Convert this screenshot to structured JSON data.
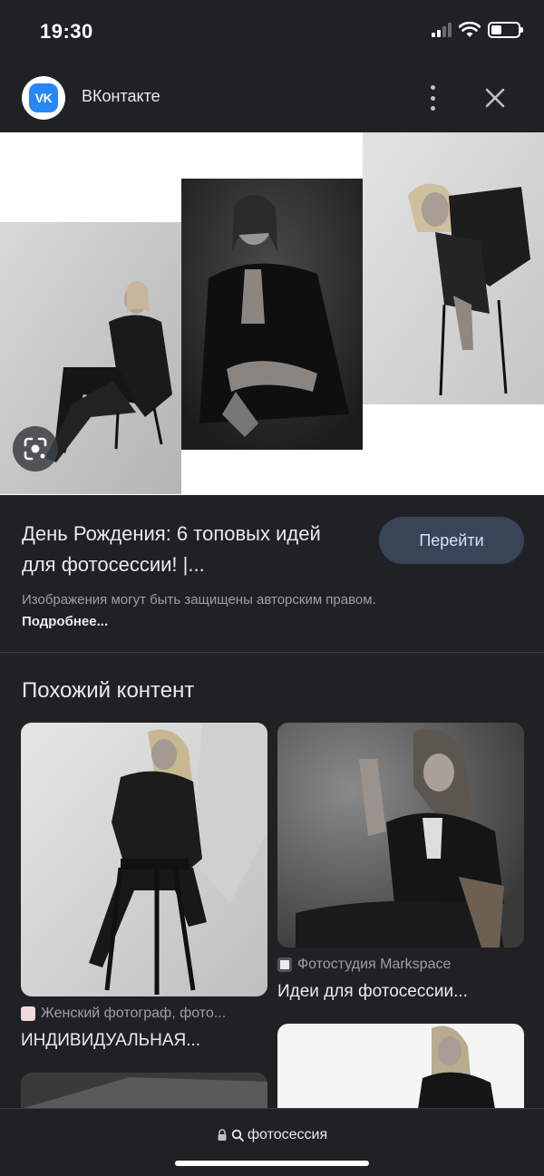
{
  "status_bar": {
    "time": "19:30"
  },
  "header": {
    "site_name": "ВКонтакте",
    "logo_text": "VK"
  },
  "result": {
    "title": "День Рождения: 6 топовых идей для фотосессии! |...",
    "visit_label": "Перейти",
    "copyright_text": "Изображения могут быть защищены авторским правом.",
    "more_link": "Подробнее..."
  },
  "related": {
    "heading": "Похожий контент",
    "cards": [
      {
        "source": "Женский фотограф, фото...",
        "title": "ИНДИВИДУАЛЬНАЯ..."
      },
      {
        "source": "Фотостудия Markspace",
        "title": "Идеи для фотосессии..."
      }
    ]
  },
  "bottom": {
    "url": "фотосессия"
  },
  "colors": {
    "background": "#202124",
    "button": "#394457",
    "accent_vk": "#2787f5"
  },
  "icons": [
    "vk-logo-icon",
    "more-vert-icon",
    "close-icon",
    "google-lens-icon",
    "lock-icon",
    "search-icon"
  ]
}
